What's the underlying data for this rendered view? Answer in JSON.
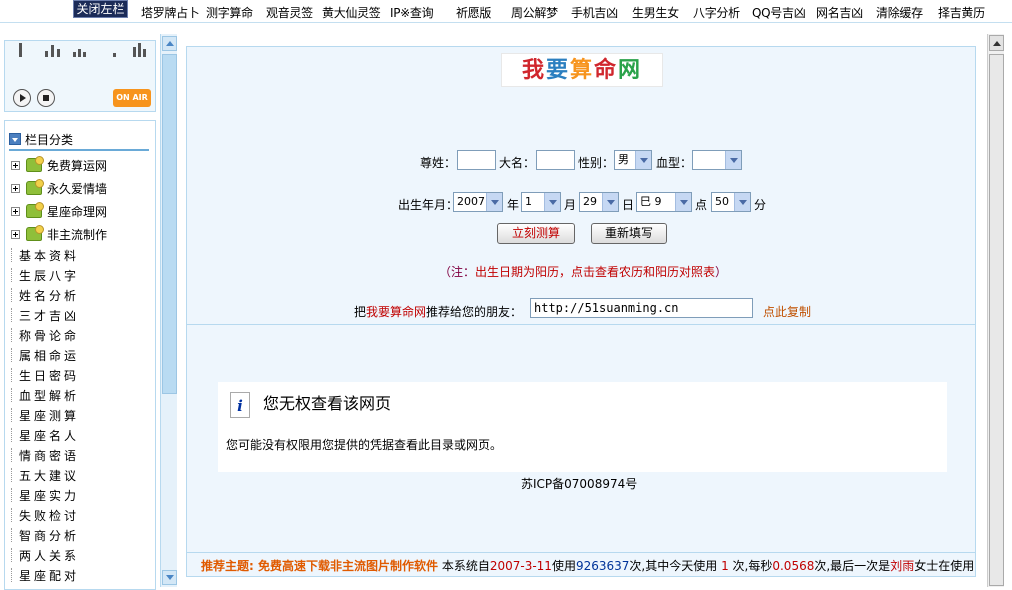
{
  "topnav": {
    "close_label": "关闭左栏",
    "links": [
      "塔罗牌占卜",
      "测字算命",
      "观音灵签",
      "黄大仙灵签",
      "IP※查询",
      "祈愿版",
      "周公解梦",
      "手机吉凶",
      "生男生女",
      "八字分析",
      "QQ号吉凶",
      "网名吉凶",
      "清除缓存",
      "择吉黄历"
    ]
  },
  "player": {
    "onair_label": "ON AIR"
  },
  "sidebar": {
    "header": "栏目分类",
    "tree_items": [
      "免费算运网",
      "永久爱情墙",
      "星座命理网",
      "非主流制作"
    ],
    "links": [
      "基本资料",
      "生辰八字",
      "姓名分析",
      "三才吉凶",
      "称骨论命",
      "属相命运",
      "生日密码",
      "血型解析",
      "星座测算",
      "星座名人",
      "情商密语",
      "五大建议",
      "星座实力",
      "失败检讨",
      "智商分析",
      "两人关系",
      "星座配对"
    ]
  },
  "logo": {
    "c1": "我",
    "c2": "要",
    "c3": "算",
    "c4": "命",
    "c5": "网"
  },
  "form": {
    "surname_label": "尊姓：",
    "name_label": "大名：",
    "gender_label": "性别：",
    "gender_value": "男",
    "blood_label": "血型：",
    "birth_label": "出生年月：",
    "year_value": "2007",
    "year_unit": "年",
    "month_value": "1",
    "month_unit": "月",
    "day_value": "29",
    "day_unit": "日",
    "hour_value": "巳 9",
    "hour_unit": "点",
    "minute_value": "50",
    "minute_unit": "分",
    "submit_label": "立刻测算",
    "reset_label": "重新填写"
  },
  "note": {
    "open": "（注：",
    "text": "出生日期为阳历，点击查看农历和阳历对照表",
    "close": "）"
  },
  "recommend": {
    "prefix": "把",
    "site": "我要算命网",
    "suffix": "推荐给您的朋友：",
    "url": "http://51suanming.cn",
    "copy_label": "点此复制"
  },
  "error": {
    "title": "您无权查看该网页",
    "message": "您可能没有权限用您提供的凭据查看此目录或网页。"
  },
  "icp": "苏ICP备07008974号",
  "footer": {
    "highlight": "推荐主题: 免费高速下载非主流图片制作软件",
    "part1": "本系统自",
    "date": "2007-3-11",
    "part2": "使用",
    "total": "9263637",
    "part3": "次,其中今天使用",
    "today": "1",
    "part4": "次,每秒",
    "rate": "0.0568",
    "part5": "次,最后一次是",
    "last_user": "刘雨",
    "part6": "女士在使用"
  }
}
